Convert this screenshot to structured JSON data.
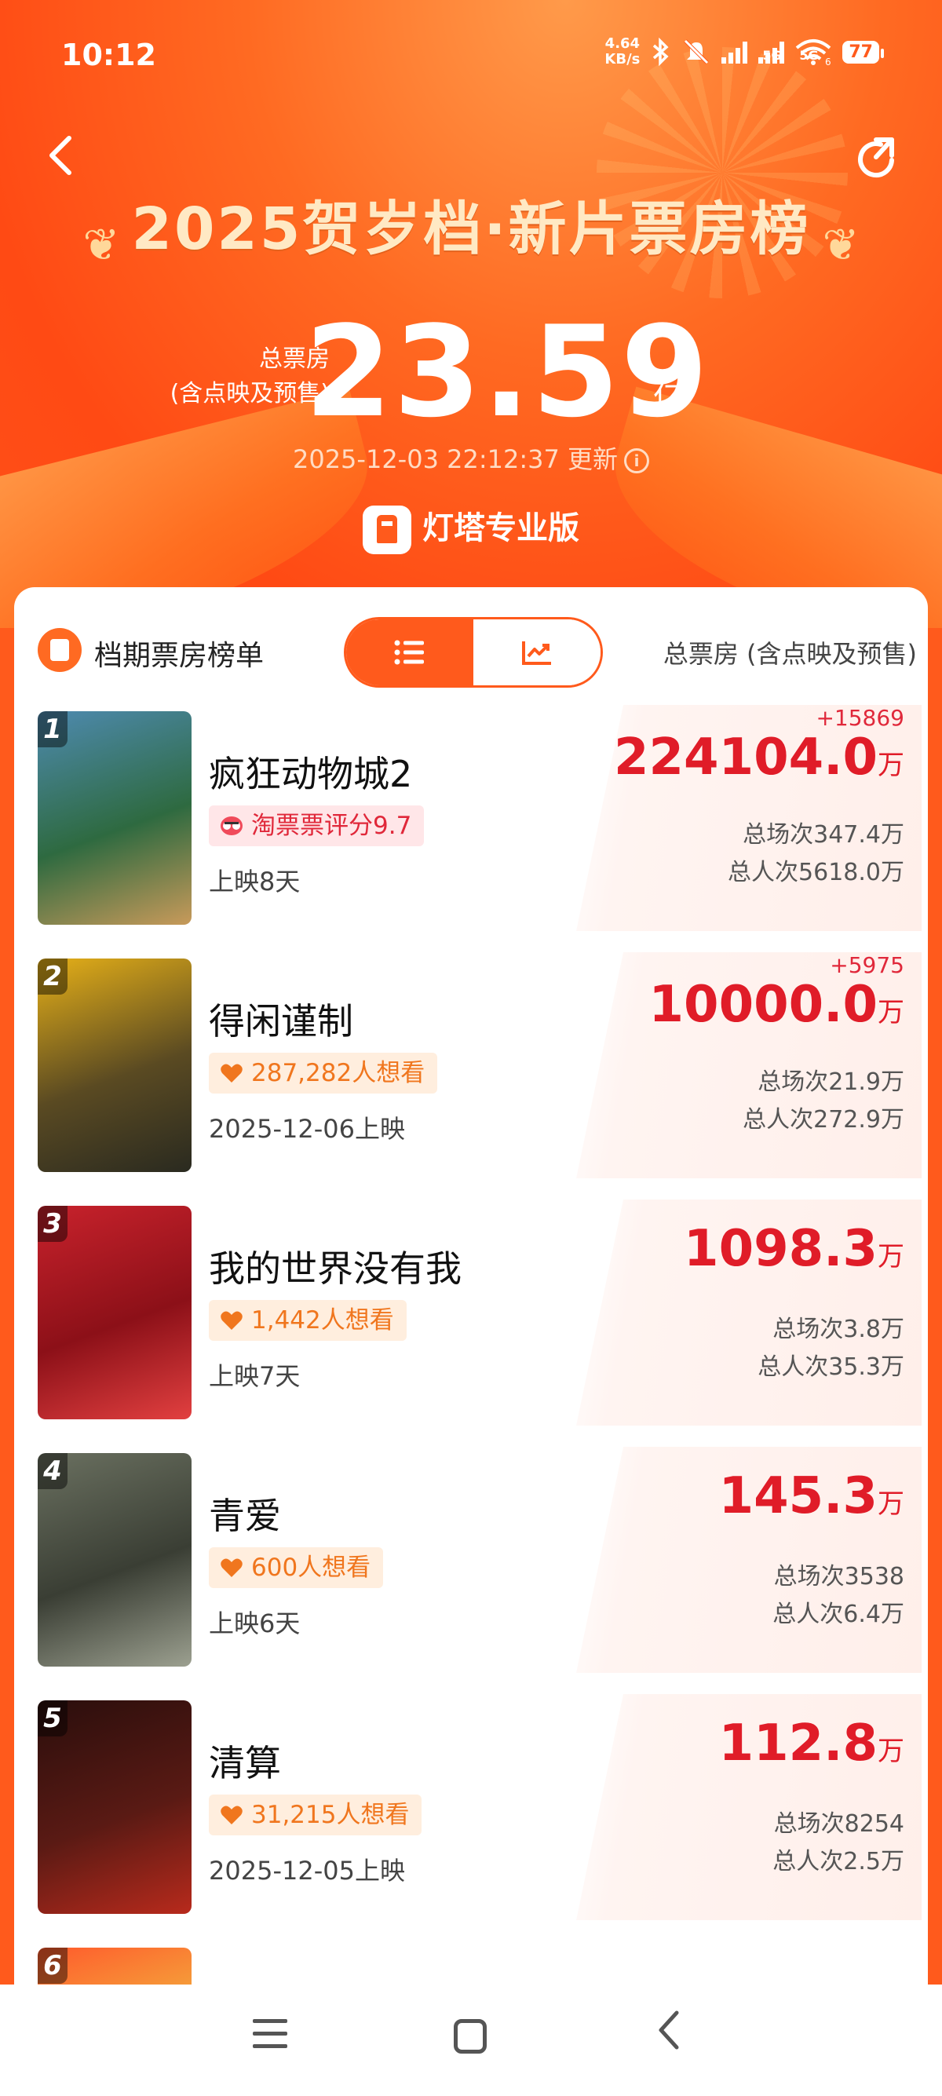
{
  "status": {
    "time": "10:12",
    "net_speed_value": "4.64",
    "net_speed_unit": "KB/s",
    "sim1": "5G",
    "sim2": "5G",
    "wifi_sub": "6",
    "battery": "77"
  },
  "header": {
    "title": "2025贺岁档·新片票房榜",
    "total_label_1": "总票房",
    "total_label_2": "(含点映及预售)",
    "total_value": "23.59",
    "total_unit": "亿",
    "update_time": "2025-12-03 22:12:37 更新",
    "brand": "灯塔专业版"
  },
  "list_header": {
    "title": "档期票房榜单",
    "right_label": "总票房 (含点映及预售)",
    "view_mode": "list"
  },
  "movies": [
    {
      "rank": "1",
      "name": "疯狂动物城2",
      "tag_type": "rating",
      "tag": "淘票票评分9.7",
      "release": "上映8天",
      "delta": "+15869",
      "gross": "224104.0",
      "unit": "万",
      "shows": "总场次347.4万",
      "admissions": "总人次5618.0万",
      "poster_colors": [
        "#4e8ab0",
        "#2e6a40",
        "#c89a5a"
      ]
    },
    {
      "rank": "2",
      "name": "得闲谨制",
      "tag_type": "want",
      "tag": "287,282人想看",
      "release": "2025-12-06上映",
      "delta": "+5975",
      "gross": "10000.0",
      "unit": "万",
      "shows": "总场次21.9万",
      "admissions": "总人次272.9万",
      "poster_colors": [
        "#e6b018",
        "#5a4a22",
        "#2a2a20"
      ]
    },
    {
      "rank": "3",
      "name": "我的世界没有我",
      "tag_type": "want",
      "tag": "1,442人想看",
      "release": "上映7天",
      "delta": "",
      "gross": "1098.3",
      "unit": "万",
      "shows": "总场次3.8万",
      "admissions": "总人次35.3万",
      "poster_colors": [
        "#c8222c",
        "#8c1018",
        "#e24040"
      ]
    },
    {
      "rank": "4",
      "name": "青爱",
      "tag_type": "want",
      "tag": "600人想看",
      "release": "上映6天",
      "delta": "",
      "gross": "145.3",
      "unit": "万",
      "shows": "总场次3538",
      "admissions": "总人次6.4万",
      "poster_colors": [
        "#6a7060",
        "#3a3e34",
        "#9ca090"
      ]
    },
    {
      "rank": "5",
      "name": "清算",
      "tag_type": "want",
      "tag": "31,215人想看",
      "release": "2025-12-05上映",
      "delta": "",
      "gross": "112.8",
      "unit": "万",
      "shows": "总场次8254",
      "admissions": "总人次2.5万",
      "poster_colors": [
        "#2a0e0c",
        "#5a1a14",
        "#b82a1c"
      ]
    },
    {
      "rank": "6",
      "name": "",
      "tag_type": "",
      "tag": "",
      "release": "",
      "delta": "",
      "gross": "",
      "unit": "",
      "shows": "",
      "admissions": "",
      "poster_colors": [
        "#ff5a2c",
        "#f0c040",
        "#c02020"
      ]
    }
  ],
  "colors": {
    "brand_orange": "#ff5a1c",
    "gross_red": "#e01c28",
    "want_orange": "#f0761e"
  }
}
